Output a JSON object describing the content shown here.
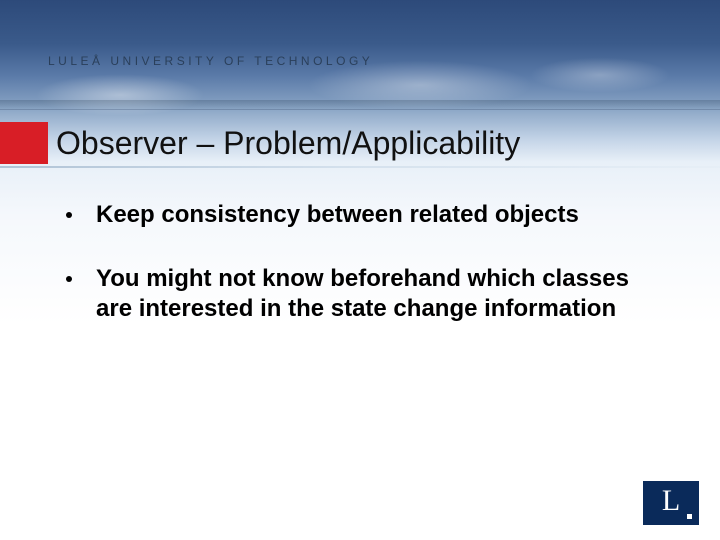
{
  "university": "LULEÅ UNIVERSITY OF TECHNOLOGY",
  "title": "Observer – Problem/Applicability",
  "bullets": [
    "Keep consistency between related objects",
    "You might not know beforehand which classes are interested in the state change information"
  ],
  "logo_letter": "L"
}
